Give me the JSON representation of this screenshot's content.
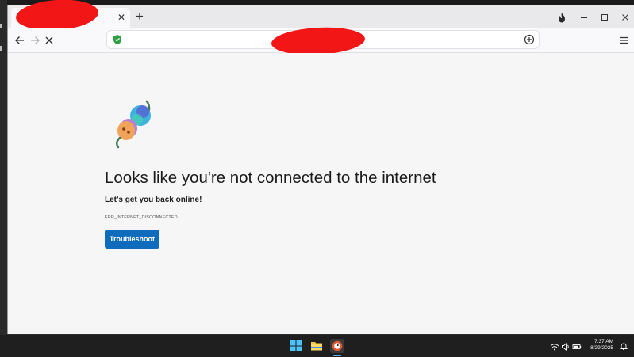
{
  "browser": {
    "tab": {
      "close_glyph": "✕",
      "new_tab_glyph": "+"
    },
    "toolbar": {
      "back_icon": "arrow-left-icon",
      "forward_icon": "arrow-right-icon",
      "stop_icon": "close-icon",
      "address": {
        "value": "",
        "security_icon": "shield-check-icon"
      },
      "reader_icon": "reader-mode-icon",
      "menu_icon": "hamburger-menu-icon"
    },
    "window_controls": [
      "flame-icon",
      "minimize-icon",
      "maximize-icon",
      "close-icon"
    ]
  },
  "page": {
    "heading": "Looks like you're not connected to the internet",
    "subheading": "Let's get you back online!",
    "error_code": "ERR_INTERNET_DISCONNECTED",
    "button_label": "Troubleshoot",
    "accent_color": "#0f6cbd"
  },
  "taskbar": {
    "apps": [
      "windows-start-icon",
      "file-explorer-icon",
      "duckduckgo-browser-icon"
    ],
    "tray": [
      "wifi-icon",
      "speaker-icon",
      "battery-icon"
    ],
    "time": "7:37 AM",
    "date": "8/29/2025",
    "notification_icon": "notification-bell-icon"
  }
}
